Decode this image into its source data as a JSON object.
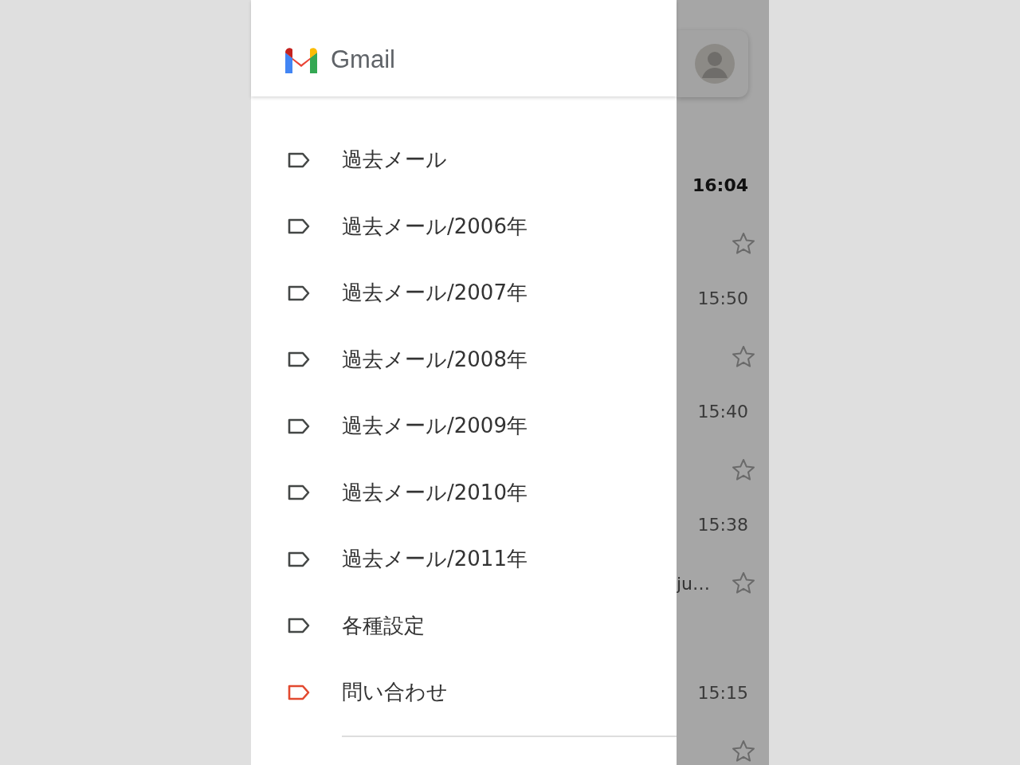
{
  "drawer": {
    "app_name": "Gmail",
    "labels": [
      {
        "name": "過去メール",
        "color": "#444746"
      },
      {
        "name": "過去メール/2006年",
        "color": "#444746"
      },
      {
        "name": "過去メール/2007年",
        "color": "#444746"
      },
      {
        "name": "過去メール/2008年",
        "color": "#444746"
      },
      {
        "name": "過去メール/2009年",
        "color": "#444746"
      },
      {
        "name": "過去メール/2010年",
        "color": "#444746"
      },
      {
        "name": "過去メール/2011年",
        "color": "#444746"
      },
      {
        "name": "各種設定",
        "color": "#444746"
      },
      {
        "name": "問い合わせ",
        "color": "#e2492f"
      }
    ]
  },
  "inbox": {
    "messages": [
      {
        "time": "16:04",
        "unread": true
      },
      {
        "time": "15:50",
        "unread": false
      },
      {
        "time": "15:40",
        "unread": false
      },
      {
        "time": "15:38",
        "unread": false,
        "snippet": "ju…"
      },
      {
        "time": "15:15",
        "unread": false
      }
    ]
  }
}
